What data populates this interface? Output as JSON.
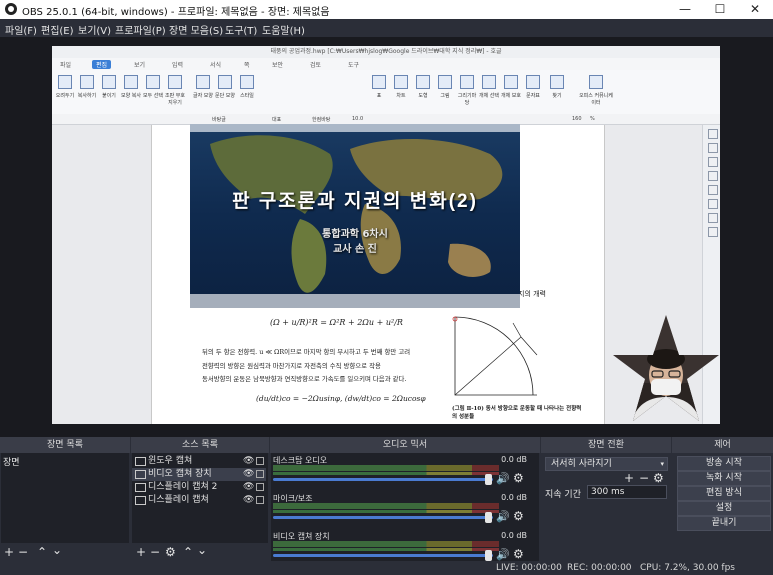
{
  "window": {
    "title": "OBS 25.0.1 (64-bit, windows) - 프로파일: 제목없음 - 장면: 제목없음",
    "minimize": "—",
    "maximize": "☐",
    "close": "✕"
  },
  "menu": [
    "파일(F)",
    "편집(E)",
    "보기(V)",
    "프로파일(P)",
    "장면 모음(S)",
    "도구(T)",
    "도움말(H)"
  ],
  "hwp": {
    "title": "태풍의 공업과정.hwp [C:₩Users₩hjslog₩Google 드라이브₩대학 지식 정리₩] - 호글",
    "tabs": [
      "파일",
      "편집",
      "보기",
      "입력",
      "서식",
      "쪽",
      "보안",
      "검토",
      "도구"
    ],
    "ribbon": [
      "오려두기",
      "복사하기",
      "붙이기",
      "모양 복사",
      "모두 선택",
      "조판 부호 지우기",
      "글자 모양",
      "문단 모양",
      "스타일",
      "표",
      "차트",
      "도형",
      "그림",
      "그리기마당",
      "개체 선택",
      "개체 보호",
      "문자표",
      "찾기",
      "오피스 커뮤니케이터"
    ],
    "format": [
      "바탕글",
      "대표",
      "한컴바탕",
      "10.0",
      "160",
      "%"
    ],
    "doc_lines": [
      "(Ω + u/R)²R = Ω²R + 2Ωu + u²/R",
      "뒤의 두 항은 전향력. u ≪ ΩR이므로 마지막 항의 무시하고 두 번째 항만 고려",
      "전향력의 방향은 원심력과 마찬가지로 자전축의 수직 방향으로 작용",
      "동서방향의 운동은 남북방향과 연직방향으로 가속도를 일으키며 다음과 같다.",
      "(du/dt)co = −2Ωusinφ,  (dw/dt)co = 2Ωucosφ",
      "지의 개력",
      "(그림 Ⅱ-10) 동서 방향으로 운동할 때 나타나는 전향력의 성분들"
    ],
    "capture": {
      "title": "판  구조론과  지권의  변화(2)",
      "subtitle": "통합과학  6차시",
      "teacher": "교사  손  진"
    }
  },
  "docks": {
    "scenes": {
      "header": "장면 목록",
      "items": [
        "장면"
      ]
    },
    "sources": {
      "header": "소스 목록",
      "items": [
        {
          "name": "윈도우 캡쳐",
          "icon": "window-icon"
        },
        {
          "name": "비디오 캡쳐 장치",
          "icon": "camera-icon"
        },
        {
          "name": "디스플레이 캡쳐 2",
          "icon": "monitor-icon"
        },
        {
          "name": "디스플레이 캡쳐",
          "icon": "monitor-icon"
        }
      ]
    },
    "mixer": {
      "header": "오디오 믹서",
      "channels": [
        {
          "name": "데스크탑 오디오",
          "db": "0.0 dB",
          "volume": 0.97
        },
        {
          "name": "마이크/보조",
          "db": "0.0 dB",
          "volume": 0.97
        },
        {
          "name": "비디오 캡쳐 장치",
          "db": "0.0 dB",
          "volume": 0.97
        }
      ]
    },
    "transitions": {
      "header": "장면 전환",
      "selected": "서서히 사라지기",
      "duration_label": "지속 기간",
      "duration": "300 ms"
    },
    "controls": {
      "header": "제어",
      "buttons": [
        "방송 시작",
        "녹화 시작",
        "편집 방식",
        "설정",
        "끝내기"
      ]
    }
  },
  "status": {
    "live": "LIVE: 00:00:00",
    "rec": "REC: 00:00:00",
    "cpu": "CPU: 7.2%, 30.00 fps"
  },
  "colors": {
    "obs_bg": "#2b2e38",
    "dock_body": "#1f2128",
    "accent": "#4a7bd1"
  }
}
